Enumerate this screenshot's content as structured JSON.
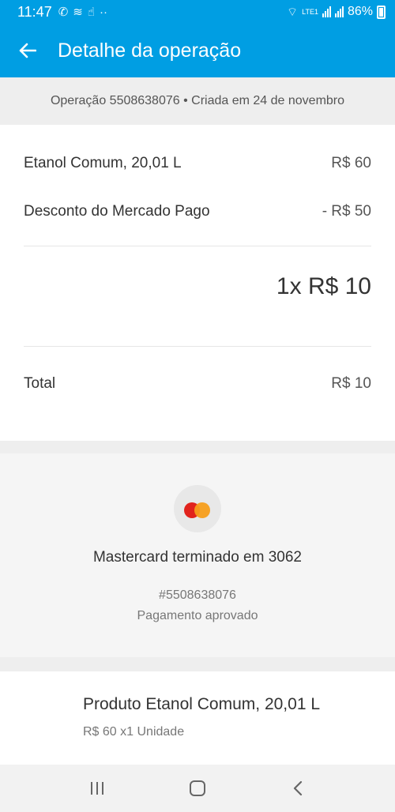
{
  "status_bar": {
    "time": "11:47",
    "network": "LTE1",
    "battery": "86%"
  },
  "app_bar": {
    "title": "Detalhe da operação"
  },
  "operation_header": {
    "text": "Operação 5508638076 • Criada em 24 de novembro"
  },
  "summary": {
    "item_label": "Etanol Comum, 20,01 L",
    "item_value": "R$ 60",
    "discount_label": "Desconto do Mercado Pago",
    "discount_value": "- R$ 50",
    "installments": "1x R$ 10",
    "total_label": "Total",
    "total_value": "R$ 10"
  },
  "payment": {
    "card_name": "Mastercard terminado em 3062",
    "operation_number": "#5508638076",
    "status": "Pagamento aprovado"
  },
  "product": {
    "name": "Produto Etanol Comum, 20,01 L",
    "detail": "R$ 60 x1 Unidade"
  },
  "icons": {
    "back": "arrow-left",
    "card_brand": "mastercard",
    "nav_recents": "recents",
    "nav_home": "home",
    "nav_back": "back"
  },
  "colors": {
    "primary": "#009ee3",
    "mastercard_red": "#e1231d",
    "mastercard_orange": "#f79e1b"
  }
}
